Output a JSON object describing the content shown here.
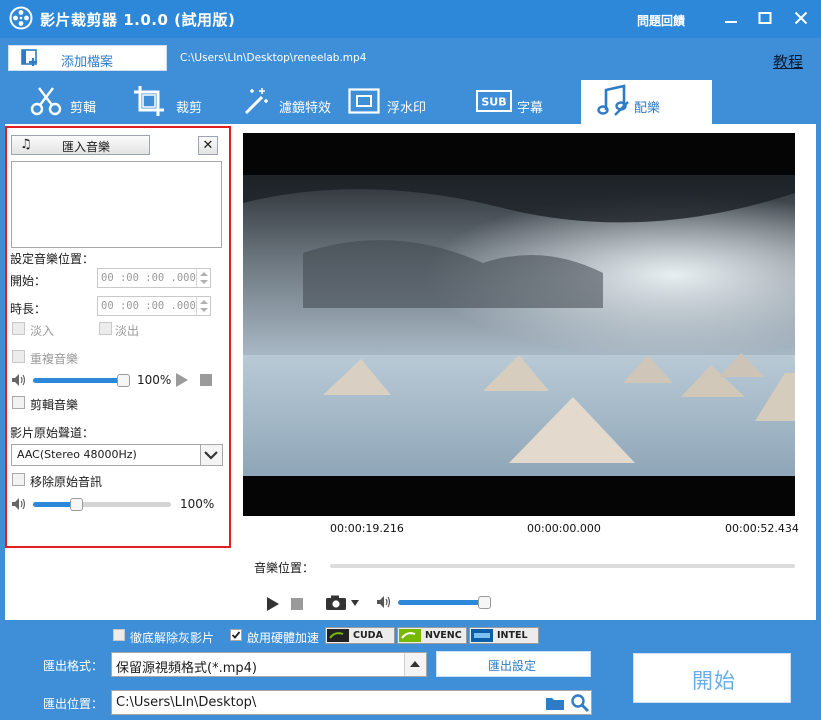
{
  "window": {
    "title": "影片裁剪器 1.0.0 (試用版)",
    "feedback_label": "問題回饋",
    "controls": [
      "minimize",
      "maximize",
      "close"
    ]
  },
  "toolbar": {
    "add_file_label": "添加檔案",
    "file_path": "C:\\Users\\LIn\\Desktop\\reneelab.mp4",
    "tutorial_label": "教程"
  },
  "tabs": [
    {
      "label": "剪輯",
      "icon": "scissors-icon",
      "active": false
    },
    {
      "label": "裁剪",
      "icon": "crop-icon",
      "active": false
    },
    {
      "label": "濾鏡特效",
      "icon": "magic-wand-icon",
      "active": false
    },
    {
      "label": "浮水印",
      "icon": "watermark-icon",
      "active": false
    },
    {
      "label": "字幕",
      "icon": "subtitle-icon",
      "active": false
    },
    {
      "label": "配樂",
      "icon": "music-icon",
      "active": true
    }
  ],
  "audio_panel": {
    "import_label": "匯入音樂",
    "close_label": "✕",
    "position_heading": "設定音樂位置：",
    "start_label": "開始：",
    "start_value": "00 :00 :00 .000",
    "duration_label": "時長：",
    "duration_value": "00 :00 :00 .000",
    "fade_in_label": "淡入",
    "fade_out_label": "淡出",
    "repeat_label": "重複音樂",
    "music_volume_text": "100%",
    "music_volume": 1.0,
    "cut_music_label": "剪輯音樂",
    "original_track_heading": "影片原始聲道：",
    "track_option": "AAC(Stereo 48000Hz)",
    "remove_original_label": "移除原始音訊",
    "original_volume_text": "100%",
    "original_volume": 0.33
  },
  "player": {
    "time_left": "00:00:19.216",
    "time_center": "00:00:00.000",
    "time_right": "00:00:52.434",
    "music_position_label": "音樂位置：",
    "player_volume": 1.0
  },
  "bottom": {
    "deinterlace_label": "徹底解除灰影片",
    "hw_accel_label": "啟用硬體加速",
    "hw_accel_checked": true,
    "badges": [
      "CUDA",
      "NVENC",
      "INTEL"
    ],
    "export_format_label": "匯出格式：",
    "export_format_value": "保留源視頻格式(*.mp4)",
    "export_settings_label": "匯出設定",
    "export_location_label": "匯出位置：",
    "export_location_value": "C:\\Users\\LIn\\Desktop\\",
    "start_label": "開始"
  },
  "colors": {
    "brand_blue": "#3f8fd8",
    "title_blue": "#2e88d9",
    "highlight_red": "#e02020",
    "link_blue": "#2e7cc6"
  }
}
